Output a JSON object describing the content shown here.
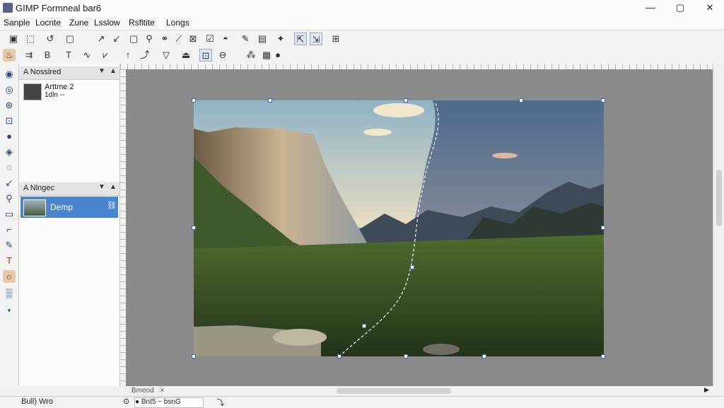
{
  "window": {
    "title": "GIMP Formneal bar6",
    "minimize": "—",
    "maximize": "▢",
    "close": "✕"
  },
  "menu": [
    "Sanple",
    "Locnte",
    "Zune",
    "Lsslow",
    "Rsfltite",
    "Longs"
  ],
  "layers_panel": {
    "header": "A Nosslred",
    "item_line1": "Arttme  2",
    "item_line2": "1dln --"
  },
  "channels_panel": {
    "header": "A Nlngec",
    "item_label": "Demp"
  },
  "canvas_tab": {
    "label": "Bmeod",
    "close": "×"
  },
  "status": {
    "left": "Bull) Wro",
    "field": "● Bnt5 − bsnG"
  },
  "icons": [
    "gimp-icon",
    "minimize-icon",
    "maximize-icon",
    "close-icon",
    "new-icon",
    "select-icon",
    "move-icon",
    "rect-icon",
    "lasso-icon",
    "text-icon",
    "crop-icon",
    "brush-icon",
    "eraser-icon",
    "grid-icon",
    "color-icon",
    "zoom-icon",
    "path-icon",
    "fuzzy-icon",
    "eye-icon",
    "chain-icon",
    "scroll-left-icon",
    "scroll-right-icon"
  ],
  "colors": {
    "canvas_bg": "#8a8a8a",
    "selection": "#3a70b8",
    "active_layer": "#4a86d0"
  }
}
